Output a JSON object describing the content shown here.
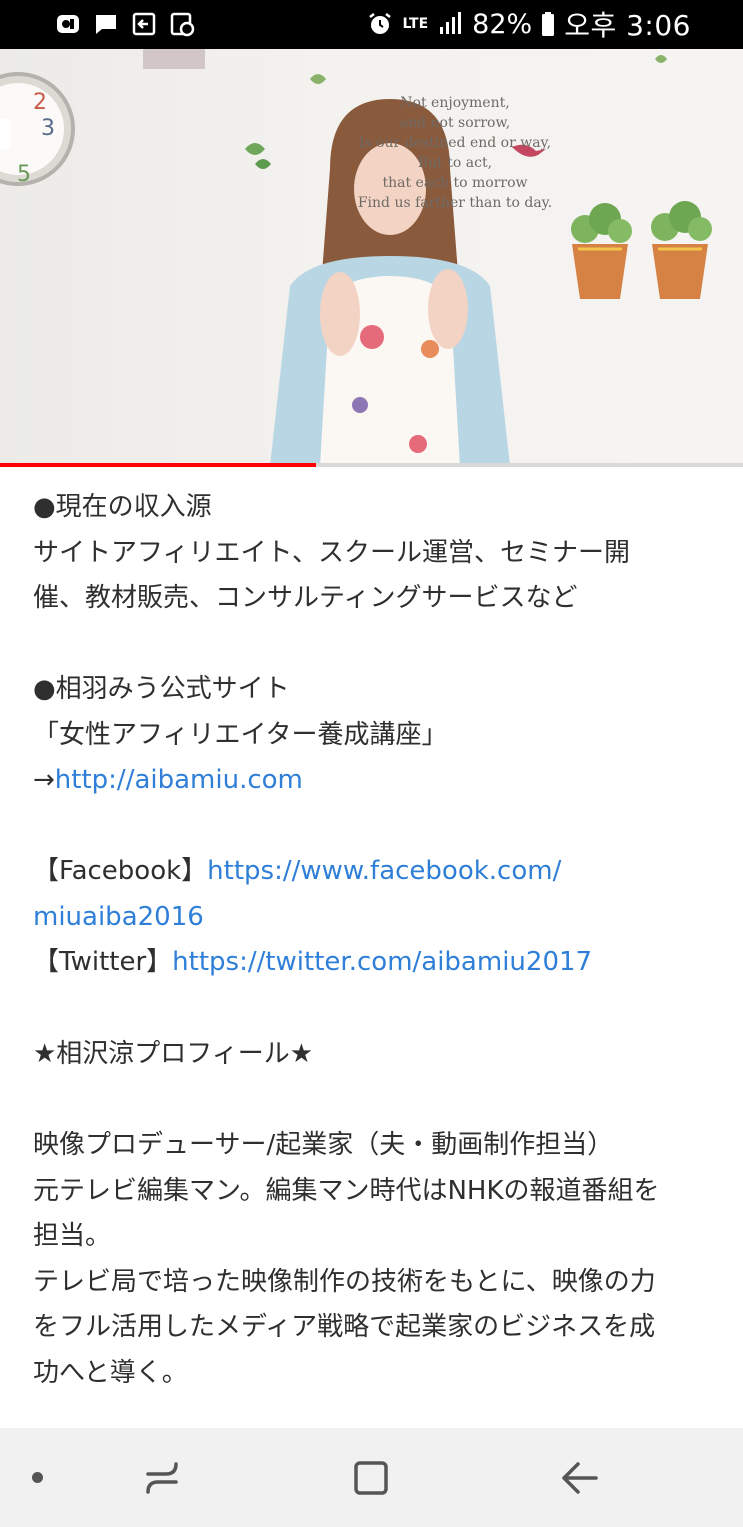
{
  "status_bar": {
    "network": "LTE",
    "battery": "82%",
    "time": "오후 3:06"
  },
  "video": {
    "wall_text": [
      "Not enjoyment,",
      "and not sorrow,",
      "Is our destined end or way,",
      "But to act,",
      "that each to morrow",
      "Find us farther than to day."
    ],
    "progress": 0.425
  },
  "description": {
    "lines": [
      {
        "type": "text",
        "text": "●現在の収入源"
      },
      {
        "type": "text",
        "text": "サイトアフィリエイト、スクール運営、セミナー開"
      },
      {
        "type": "text",
        "text": "催、教材販売、コンサルティングサービスなど"
      },
      {
        "type": "blank"
      },
      {
        "type": "text",
        "text": "●相羽みう公式サイト"
      },
      {
        "type": "text",
        "text": "「女性アフィリエイター養成講座」"
      },
      {
        "type": "mixed",
        "prefix": "→",
        "link": "http://aibamiu.com"
      },
      {
        "type": "blank"
      },
      {
        "type": "mixed",
        "prefix": "【Facebook】",
        "link": "https://www.facebook.com/"
      },
      {
        "type": "link",
        "link": "miuaiba2016"
      },
      {
        "type": "mixed",
        "prefix": "【Twitter】",
        "link": "https://twitter.com/aibamiu2017"
      },
      {
        "type": "blank"
      },
      {
        "type": "half"
      },
      {
        "type": "text",
        "text": "★相沢涼プロフィール★"
      },
      {
        "type": "blank"
      },
      {
        "type": "text",
        "text": "映像プロデューサー/起業家（夫・動画制作担当）"
      },
      {
        "type": "text",
        "text": "元テレビ編集マン。編集マン時代はNHKの報道番組を"
      },
      {
        "type": "text",
        "text": "担当。"
      },
      {
        "type": "text",
        "text": "テレビ局で培った映像制作の技術をもとに、映像の力"
      },
      {
        "type": "text",
        "text": "をフル活用したメディア戦略で起業家のビジネスを成"
      },
      {
        "type": "text",
        "text": "功へと導く。"
      }
    ]
  },
  "colors": {
    "link": "#2f7fd8",
    "progress": "#ff0000",
    "status_bar": "#000000",
    "nav_bar": "#f1f1f1"
  },
  "nav_bar": {
    "icons": [
      "dot-indicator-icon",
      "recent-apps-icon",
      "home-icon",
      "back-icon"
    ]
  }
}
